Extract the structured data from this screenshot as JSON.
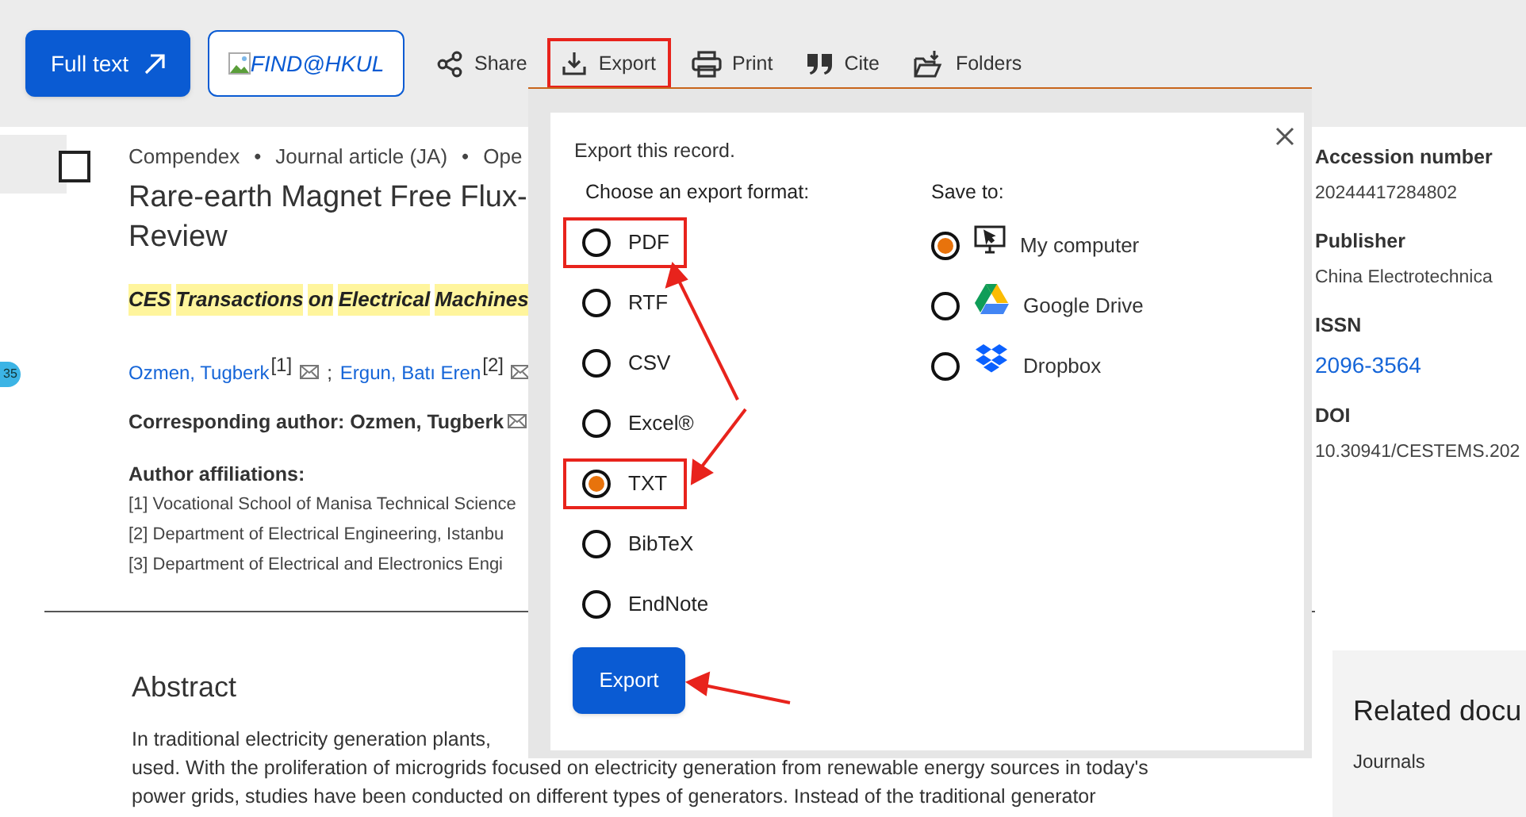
{
  "toolbar": {
    "full_text": "Full text",
    "find_button": "FIND@HKUL",
    "actions": [
      {
        "label": "Share",
        "kind": "share",
        "annotated": false
      },
      {
        "label": "Export",
        "kind": "export",
        "annotated": true
      },
      {
        "label": "Print",
        "kind": "print",
        "annotated": false
      },
      {
        "label": "Cite",
        "kind": "cite",
        "annotated": false
      },
      {
        "label": "Folders",
        "kind": "folders",
        "annotated": false
      }
    ]
  },
  "record": {
    "checked": false,
    "badge": "35",
    "meta": [
      "Compendex",
      "•",
      "Journal article (JA)",
      "•",
      "Ope"
    ],
    "title_lines": [
      "Rare-earth Magnet Free Flux-",
      "Review"
    ],
    "journal": [
      {
        "text": "CES",
        "highlighted": true
      },
      {
        "text": "Transactions",
        "highlighted": true
      },
      {
        "text": "on",
        "highlighted": true
      },
      {
        "text": "Electrical",
        "highlighted": true
      },
      {
        "text": "Machines",
        "highlighted": true
      }
    ],
    "authors": [
      {
        "name": "Ozmen, Tugberk",
        "ref": "[1]",
        "separator": ";"
      },
      {
        "name": "Ergun, Batı Eren",
        "ref": "[2]"
      }
    ],
    "corresponding": "Corresponding author: Ozmen, Tugberk",
    "affiliations_heading": "Author affiliations:",
    "affiliations": [
      "[1] Vocational School of Manisa Technical Science",
      "[2] Department of Electrical Engineering, Istanbu",
      "[3] Department of Electrical and Electronics Engi"
    ]
  },
  "abstract": {
    "heading": "Abstract",
    "lines": [
      "In traditional electricity generation plants,",
      "used. With the proliferation of microgrids focused on electricity generation from renewable energy sources in today's",
      "power grids, studies have been conducted on different types of generators. Instead of the traditional generator"
    ]
  },
  "details": [
    {
      "label": "Accession number",
      "value": "20244417284802",
      "link": false
    },
    {
      "label": "Publisher",
      "value": "China Electrotechnica",
      "link": false
    },
    {
      "label": "ISSN",
      "value": "2096-3564",
      "link": true
    },
    {
      "label": "DOI",
      "value": "10.30941/CESTEMS.202",
      "link": false
    }
  ],
  "related": {
    "heading": "Related docu",
    "subheading": "Journals"
  },
  "dialog": {
    "intro": "Export this record.",
    "format_heading": "Choose an export format:",
    "formats": [
      {
        "label": "PDF",
        "selected": false,
        "annotated": true
      },
      {
        "label": "RTF",
        "selected": false,
        "annotated": false
      },
      {
        "label": "CSV",
        "selected": false,
        "annotated": false
      },
      {
        "label": "Excel®",
        "selected": false,
        "annotated": false
      },
      {
        "label": "TXT",
        "selected": true,
        "annotated": true
      },
      {
        "label": "BibTeX",
        "selected": false,
        "annotated": false
      },
      {
        "label": "EndNote",
        "selected": false,
        "annotated": false
      }
    ],
    "destination_heading": "Save to:",
    "destinations": [
      {
        "label": "My computer",
        "kind": "computer",
        "selected": true
      },
      {
        "label": "Google Drive",
        "kind": "drive",
        "selected": false
      },
      {
        "label": "Dropbox",
        "kind": "dropbox",
        "selected": false
      }
    ],
    "export_button": {
      "label": "Export",
      "annotated": true
    }
  }
}
